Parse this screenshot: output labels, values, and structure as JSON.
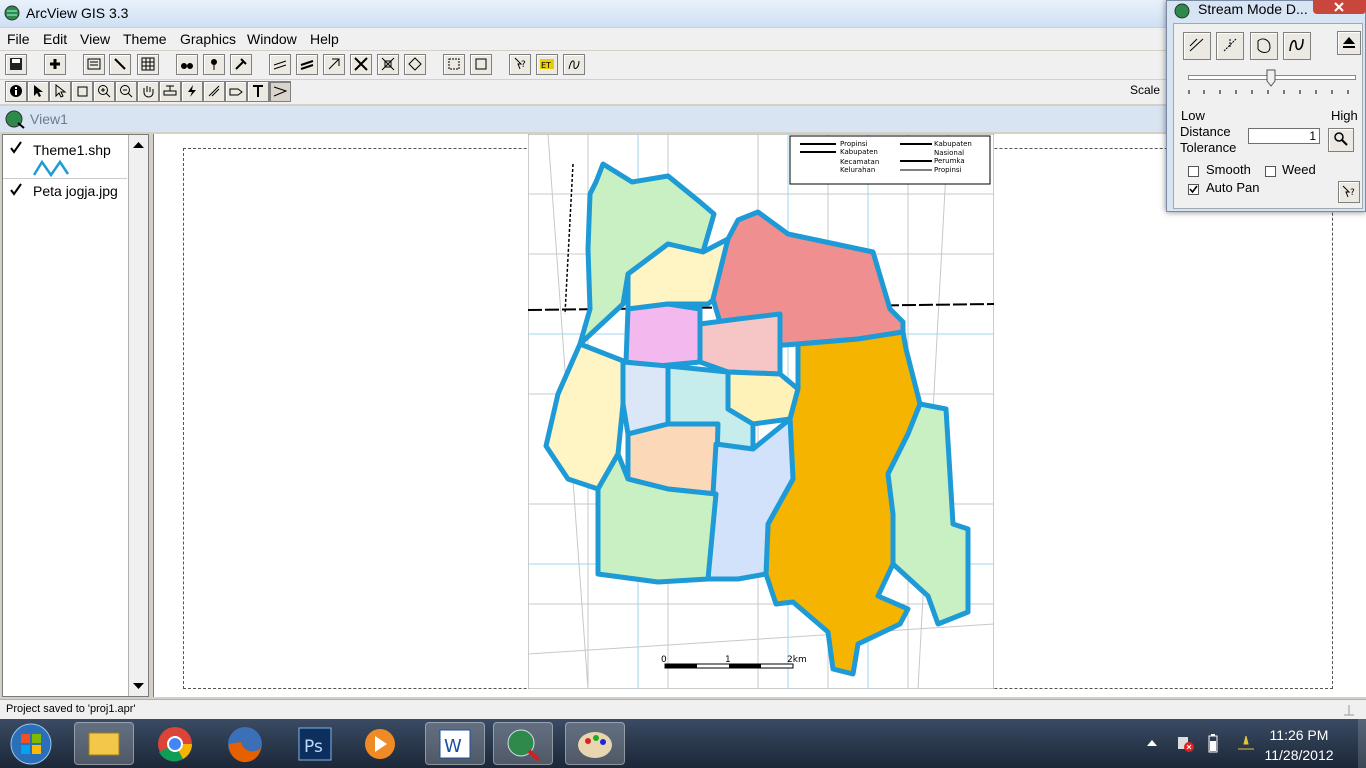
{
  "window": {
    "title": "ArcView GIS 3.3"
  },
  "menu": [
    "File",
    "Edit",
    "View",
    "Theme",
    "Graphics",
    "Window",
    "Help"
  ],
  "toolbar": {
    "scale_label": "Scale"
  },
  "view": {
    "title": "View1"
  },
  "toc": {
    "themes": [
      {
        "name": "Theme1.shp",
        "checked": true
      },
      {
        "name": "Peta jogja.jpg",
        "checked": true
      }
    ]
  },
  "map": {
    "legend": [
      "Propinsi",
      "Kabupaten",
      "Kecamatan",
      "Kelurahan",
      "Kabupaten",
      "Nasional",
      "Perumka",
      "Propinsi"
    ],
    "scalebar": [
      "0",
      "1",
      "2km"
    ]
  },
  "status": {
    "text": "Project saved to 'proj1.apr'"
  },
  "stream_dialog": {
    "title": "Stream Mode D...",
    "low_label": "Low",
    "high_label": "High",
    "distance_label": "Distance",
    "tolerance_label": "Tolerance",
    "tolerance_value": "1",
    "smooth_label": "Smooth",
    "weed_label": "Weed",
    "autopan_label": "Auto Pan",
    "smooth_checked": false,
    "weed_checked": false,
    "autopan_checked": true,
    "slider_value": 0.5
  },
  "taskbar": {
    "time": "11:26 PM",
    "date": "11/28/2012"
  },
  "colors": {
    "boundary": "#1e9bd7",
    "orange": "#f5b400",
    "red": "#f08f8f",
    "green": "#c9f0c3"
  }
}
